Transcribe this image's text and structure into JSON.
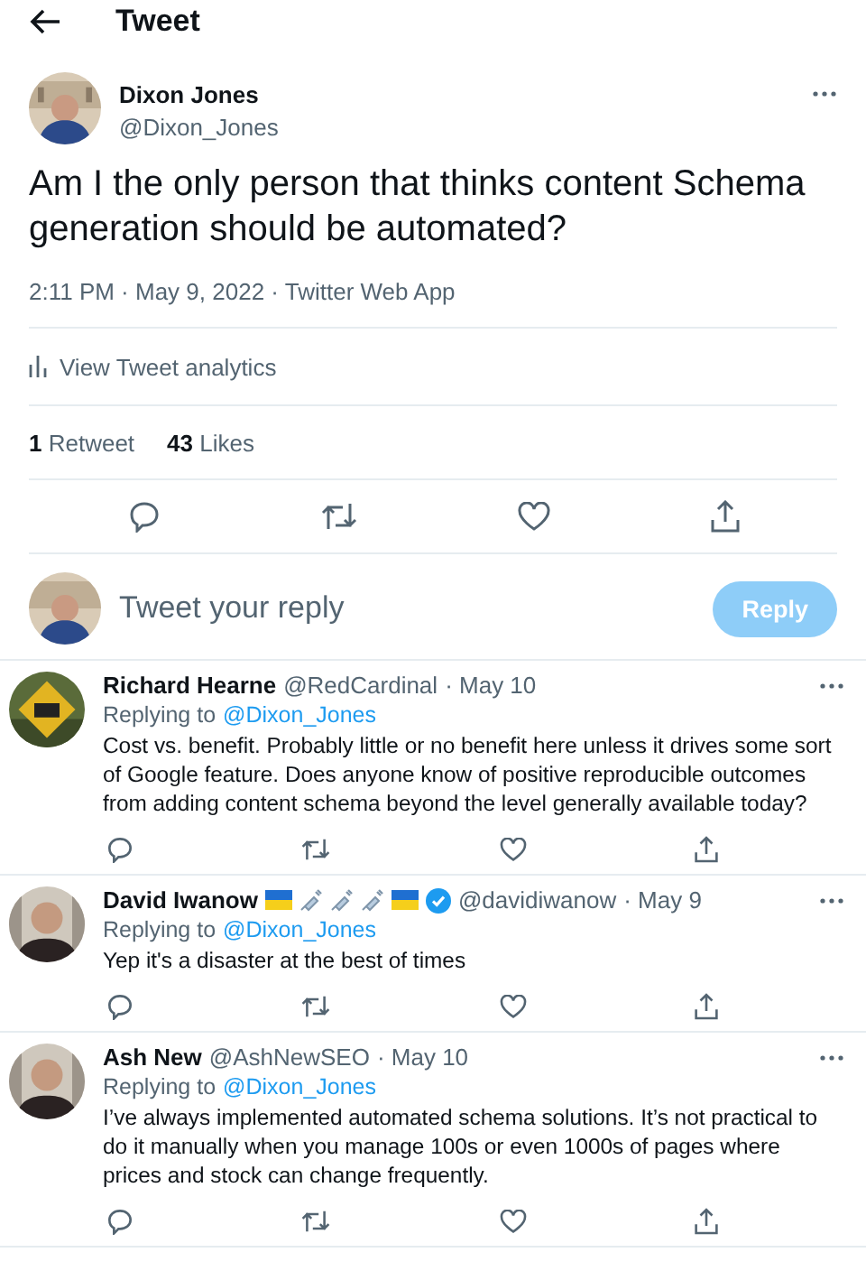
{
  "header": {
    "title": "Tweet"
  },
  "tweet": {
    "name": "Dixon Jones",
    "handle": "@Dixon_Jones",
    "text": "Am I the only person that thinks content Schema generation should be automated?",
    "meta": "2:11 PM · May 9, 2022 · Twitter Web App",
    "analytics": "View Tweet analytics",
    "stats": [
      {
        "count": "1",
        "label": "Retweet"
      },
      {
        "count": "43",
        "label": "Likes"
      }
    ]
  },
  "composer": {
    "placeholder": "Tweet your reply",
    "button": "Reply",
    "disabled": true
  },
  "replies": [
    {
      "name": "Richard Hearne",
      "verified": false,
      "handle": "@RedCardinal",
      "date": "· May 10",
      "replying_prefix": "Replying to",
      "replying_to": "@Dixon_Jones",
      "text": "Cost vs. benefit. Probably little or no benefit here unless it drives some sort of Google feature. Does anyone know of positive reproducible outcomes from adding content schema beyond the level generally available today?"
    },
    {
      "name": "David Iwanow",
      "badges": [
        {
          "kind": "flag"
        },
        {
          "kind": "syringe"
        },
        {
          "kind": "syringe"
        },
        {
          "kind": "syringe"
        },
        {
          "kind": "flag"
        }
      ],
      "verified": true,
      "handle": "@davidiwanow",
      "date": "· May 9",
      "replying_prefix": "Replying to",
      "replying_to": "@Dixon_Jones",
      "text": "Yep it's a disaster at the best of times"
    },
    {
      "name": "Ash New",
      "verified": false,
      "handle": "@AshNewSEO",
      "date": "· May 10",
      "replying_prefix": "Replying to",
      "replying_to": "@Dixon_Jones",
      "text": "I’ve always implemented automated schema solutions. It’s not practical to do it manually when you manage 100s or even 1000s of pages where prices and stock can change frequently."
    }
  ]
}
